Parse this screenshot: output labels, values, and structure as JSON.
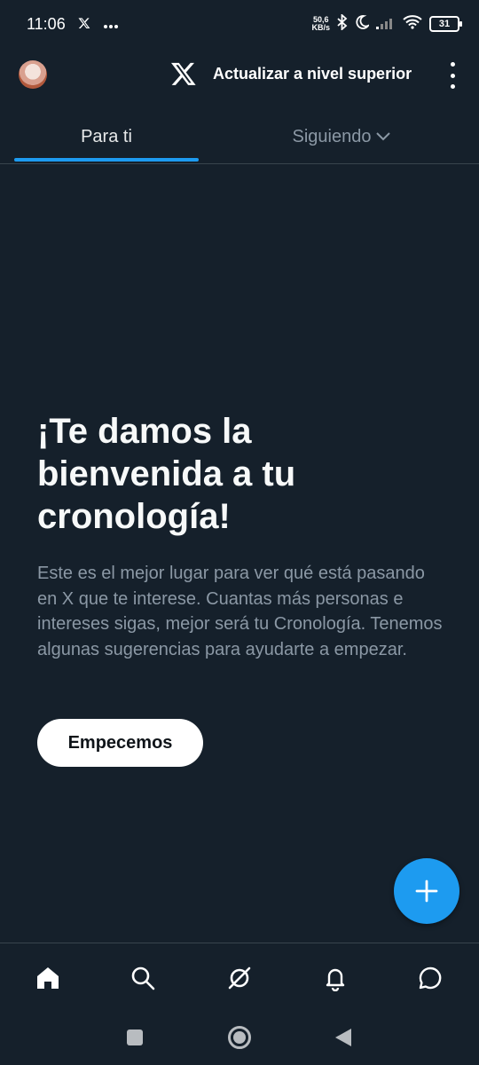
{
  "status_bar": {
    "time": "11:06",
    "net_speed_value": "50,6",
    "net_speed_unit": "KB/s",
    "battery": "31"
  },
  "header": {
    "upgrade_label": "Actualizar a nivel superior"
  },
  "tabs": [
    {
      "label": "Para ti",
      "selected": true
    },
    {
      "label": "Siguiendo",
      "selected": false
    }
  ],
  "welcome": {
    "title": "¡Te damos la bienvenida a tu cronología!",
    "description": "Este es el mejor lugar para ver qué está pasando en X que te interese. Cuantas más personas e intereses sigas, mejor será tu Cronología. Tenemos algunas sugerencias para ayudarte a empezar.",
    "button_label": "Empecemos"
  },
  "bottom_nav": [
    "home-icon",
    "search-icon",
    "grok-icon",
    "bell-icon",
    "messages-icon"
  ],
  "colors": {
    "background": "#15202b",
    "accent": "#1d9bf0",
    "muted_text": "#8b98a5",
    "divider": "#38444d"
  }
}
